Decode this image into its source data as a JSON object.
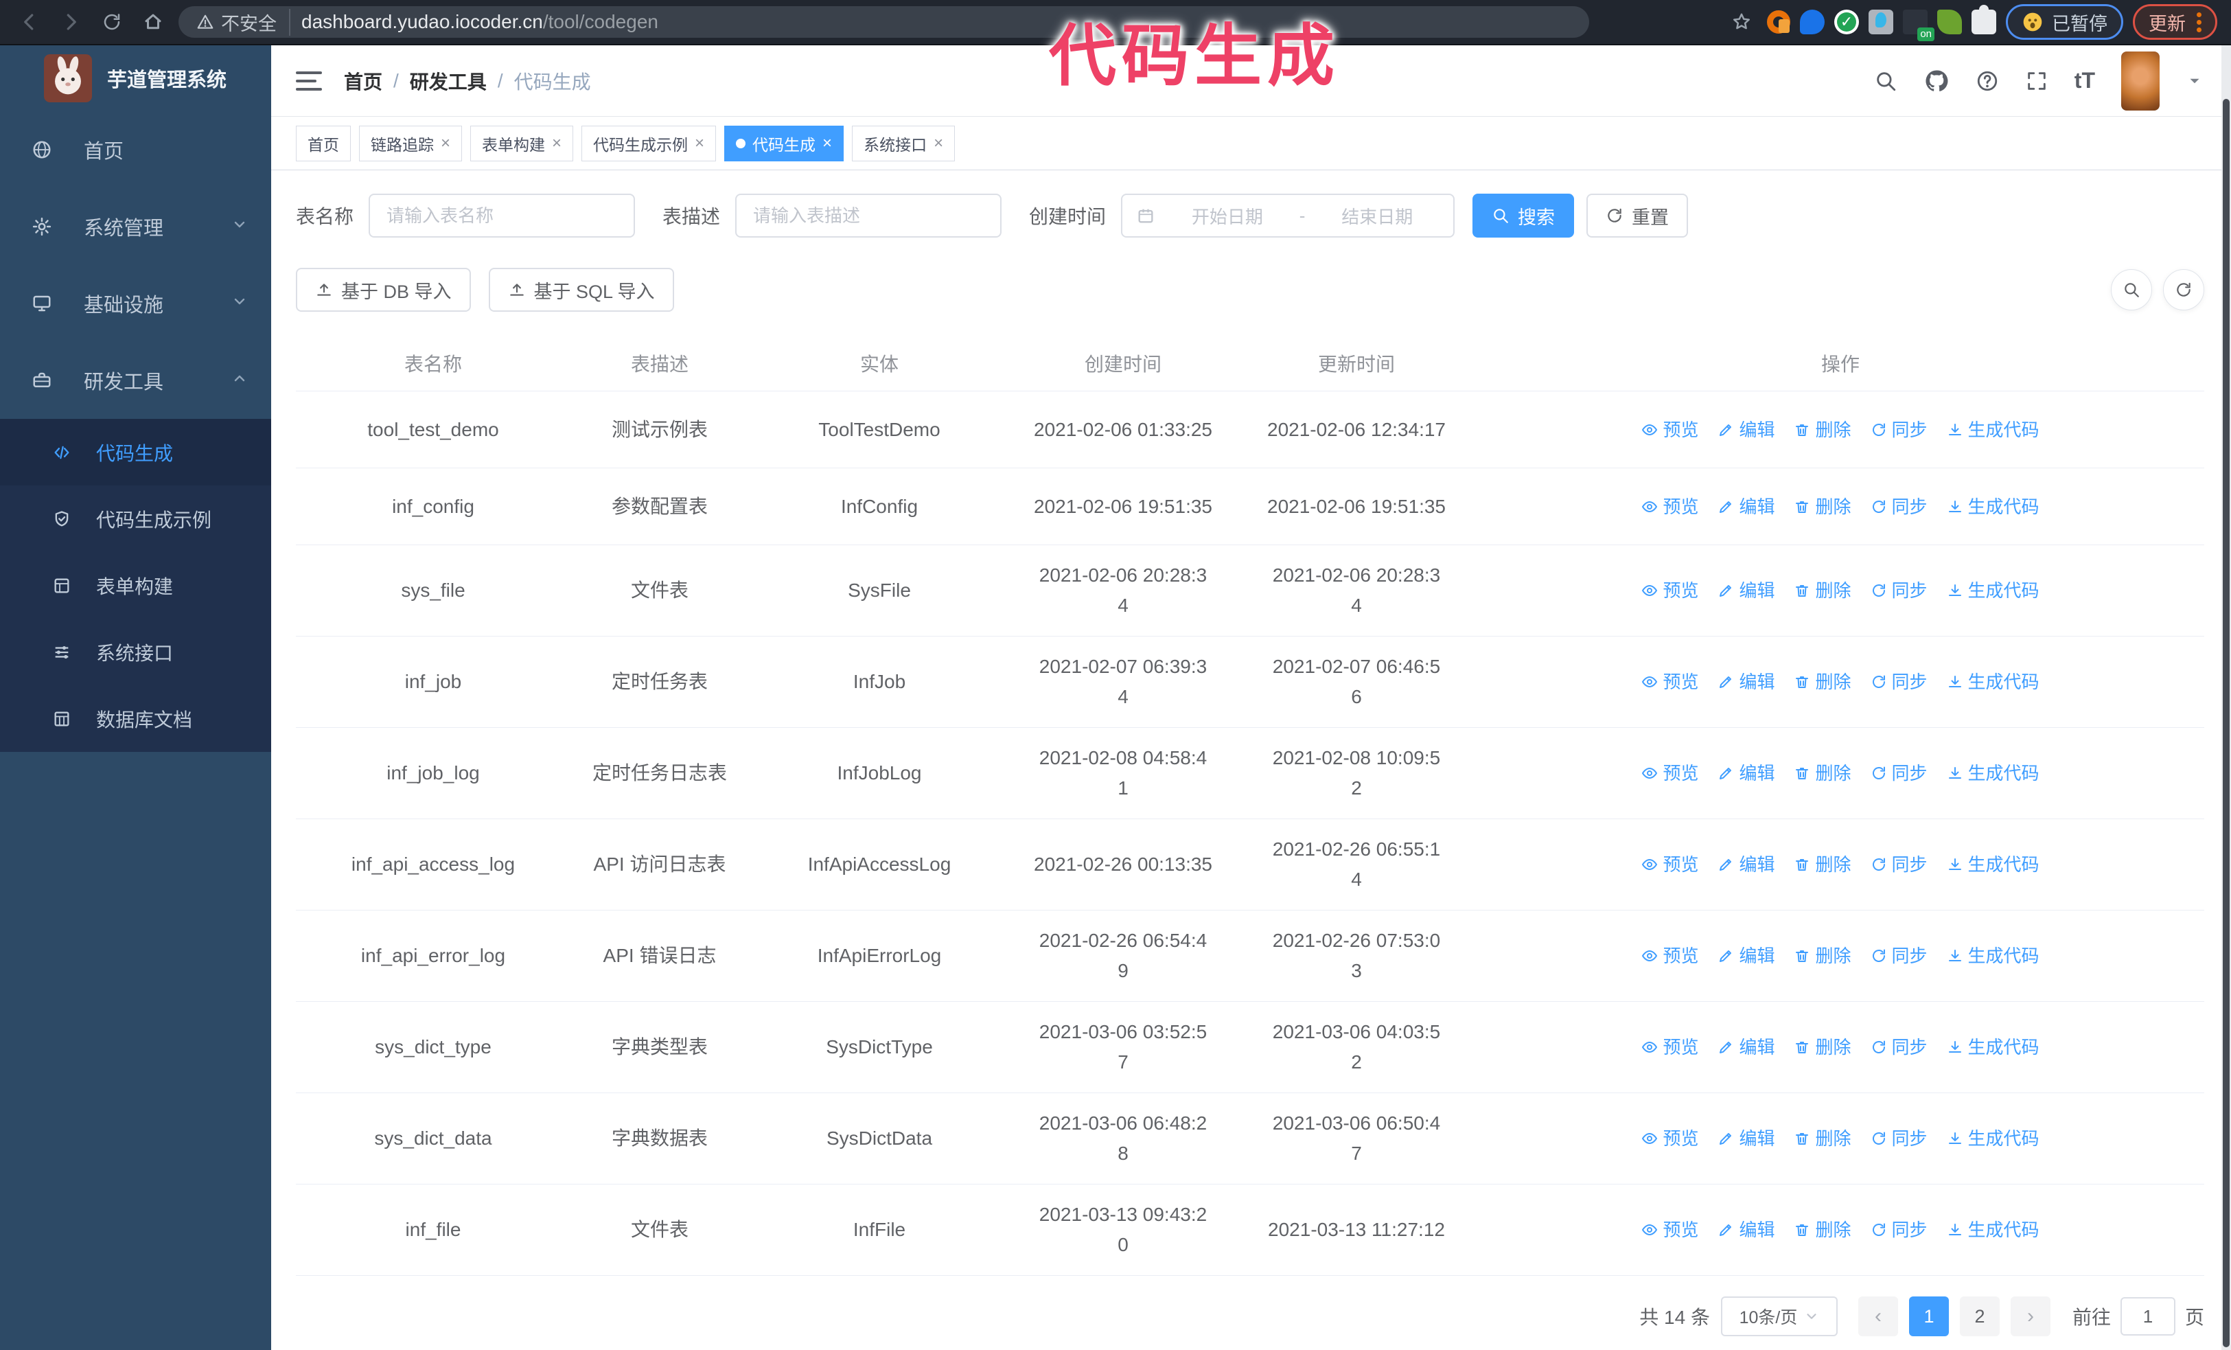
{
  "colors": {
    "accent": "#409eff",
    "annotation": "#ee4166",
    "sidebar_bg": "#2d4a66",
    "submenu_bg": "#20304d"
  },
  "ui": {
    "close_glyph": "×",
    "text_size_glyph": "tT",
    "prev_glyph": "‹",
    "next_glyph": "›"
  },
  "annotation": {
    "text": "代码生成"
  },
  "browser": {
    "security_label": "不安全",
    "url_host": "dashboard.yudao.iocoder.cn",
    "url_path": "/tool/codegen",
    "paused_badge": "已暂停",
    "update_button": "更新"
  },
  "sidebar": {
    "title": "芋道管理系统",
    "items": [
      {
        "label": "首页"
      },
      {
        "label": "系统管理"
      },
      {
        "label": "基础设施"
      },
      {
        "label": "研发工具"
      }
    ],
    "submenu": [
      {
        "label": "代码生成"
      },
      {
        "label": "代码生成示例"
      },
      {
        "label": "表单构建"
      },
      {
        "label": "系统接口"
      },
      {
        "label": "数据库文档"
      }
    ]
  },
  "breadcrumb": {
    "separator": "/",
    "items": [
      "首页",
      "研发工具",
      "代码生成"
    ]
  },
  "tabs": [
    {
      "label": "首页"
    },
    {
      "label": "链路追踪"
    },
    {
      "label": "表单构建"
    },
    {
      "label": "代码生成示例"
    },
    {
      "label": "代码生成"
    },
    {
      "label": "系统接口"
    }
  ],
  "filters": {
    "table_name_label": "表名称",
    "table_name_placeholder": "请输入表名称",
    "table_desc_label": "表描述",
    "table_desc_placeholder": "请输入表描述",
    "create_time_label": "创建时间",
    "date_start_placeholder": "开始日期",
    "date_separator": "-",
    "date_end_placeholder": "结束日期",
    "search_button": "搜索",
    "reset_button": "重置"
  },
  "toolbar": {
    "import_db_button": "基于 DB 导入",
    "import_sql_button": "基于 SQL 导入"
  },
  "table": {
    "columns": [
      "表名称",
      "表描述",
      "实体",
      "创建时间",
      "更新时间",
      "操作"
    ],
    "row_actions": [
      "预览",
      "编辑",
      "删除",
      "同步",
      "生成代码"
    ],
    "rows": [
      {
        "name": "tool_test_demo",
        "desc": "测试示例表",
        "entity": "ToolTestDemo",
        "created": "2021-02-06 01:33:25",
        "updated": "2021-02-06 12:34:17"
      },
      {
        "name": "inf_config",
        "desc": "参数配置表",
        "entity": "InfConfig",
        "created": "2021-02-06 19:51:35",
        "updated": "2021-02-06 19:51:35"
      },
      {
        "name": "sys_file",
        "desc": "文件表",
        "entity": "SysFile",
        "created": "2021-02-06 20:28:34",
        "updated": "2021-02-06 20:28:34"
      },
      {
        "name": "inf_job",
        "desc": "定时任务表",
        "entity": "InfJob",
        "created": "2021-02-07 06:39:34",
        "updated": "2021-02-07 06:46:56"
      },
      {
        "name": "inf_job_log",
        "desc": "定时任务日志表",
        "entity": "InfJobLog",
        "created": "2021-02-08 04:58:41",
        "updated": "2021-02-08 10:09:52"
      },
      {
        "name": "inf_api_access_log",
        "desc": "API 访问日志表",
        "entity": "InfApiAccessLog",
        "created": "2021-02-26 00:13:35",
        "updated": "2021-02-26 06:55:14"
      },
      {
        "name": "inf_api_error_log",
        "desc": "API 错误日志",
        "entity": "InfApiErrorLog",
        "created": "2021-02-26 06:54:49",
        "updated": "2021-02-26 07:53:03"
      },
      {
        "name": "sys_dict_type",
        "desc": "字典类型表",
        "entity": "SysDictType",
        "created": "2021-03-06 03:52:57",
        "updated": "2021-03-06 04:03:52"
      },
      {
        "name": "sys_dict_data",
        "desc": "字典数据表",
        "entity": "SysDictData",
        "created": "2021-03-06 06:48:28",
        "updated": "2021-03-06 06:50:47"
      },
      {
        "name": "inf_file",
        "desc": "文件表",
        "entity": "InfFile",
        "created": "2021-03-13 09:43:20",
        "updated": "2021-03-13 11:27:12"
      }
    ]
  },
  "pagination": {
    "total": "共 14 条",
    "page_size": "10条/页",
    "pages": [
      "1",
      "2"
    ],
    "goto_label": "前往",
    "goto_value": "1",
    "goto_suffix": "页"
  }
}
